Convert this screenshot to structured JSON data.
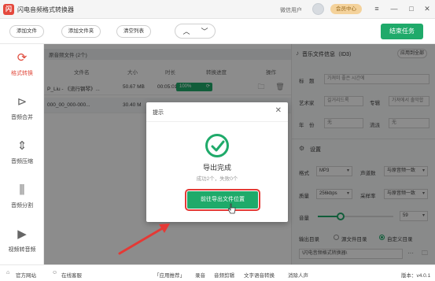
{
  "app": {
    "title": "闪电音频格式转换器",
    "logo": "闪",
    "login_text": "微信用户",
    "vip_label": "会员中心"
  },
  "toolbar": {
    "add_file": "添加文件",
    "add_folder": "添加文件夹",
    "clear_list": "清空列表",
    "start_label": "结束任务"
  },
  "sidebar": {
    "items": [
      {
        "label": "格式转换",
        "icon": "refresh-icon"
      },
      {
        "label": "音频合并",
        "icon": "merge-icon"
      },
      {
        "label": "音频压缩",
        "icon": "compress-icon"
      },
      {
        "label": "音频分割",
        "icon": "split-icon"
      },
      {
        "label": "视频转音频",
        "icon": "video-icon"
      }
    ]
  },
  "filelist": {
    "heading": "原音频文件 (2个)",
    "columns": [
      "文件名",
      "大小",
      "时长",
      "转换进度",
      "操作"
    ],
    "rows": [
      {
        "name": "P_Liu - 《流行钢琴》...",
        "size": "50.67 MB",
        "duration": "00:05:01",
        "progress": "100%"
      },
      {
        "name": "000_00_000-000...",
        "size": "30.40 M",
        "duration": "",
        "progress": ""
      }
    ]
  },
  "info": {
    "title": "音乐文件信息（ID3）",
    "apply_all": "应用到全部",
    "title_label": "标　题",
    "title_value": "가져미 좋은 시간에",
    "artist_label": "艺术家",
    "artist_value": "길거리드록",
    "album_label": "专辑",
    "album_value": "가져에서 출막합",
    "year_label": "年　份",
    "year_value": "无",
    "genre_label": "流派",
    "genre_value": "无"
  },
  "settings": {
    "title": "设置",
    "format_label": "格式",
    "format_value": "MP3",
    "channel_label": "声道数",
    "channel_value": "与原音频一致",
    "quality_label": "质量",
    "quality_value": "256kbps",
    "sample_label": "采样率",
    "sample_value": "与原音频一致",
    "volume_label": "音量",
    "volume_value": "59",
    "volume_level": 0.3,
    "output_label": "输出目录",
    "opt_source": "源文件目录",
    "opt_custom": "自定义目录",
    "path": "\\闪电音频格式转换器\\"
  },
  "dialog": {
    "title": "提示",
    "main": "导出完成",
    "sub": "成功2个，失败0个",
    "button": "前往导出文件位置"
  },
  "statusbar": {
    "website": "官方网站",
    "service": "在线客服",
    "links": [
      "「应用推荐」",
      "录音",
      "音频剪辑",
      "文字语音转换",
      "消除人声"
    ],
    "version": "版本：v4.0.1"
  },
  "colors": {
    "accent": "#1faa6a",
    "active": "#e04a3c",
    "annotation": "#e53935"
  }
}
